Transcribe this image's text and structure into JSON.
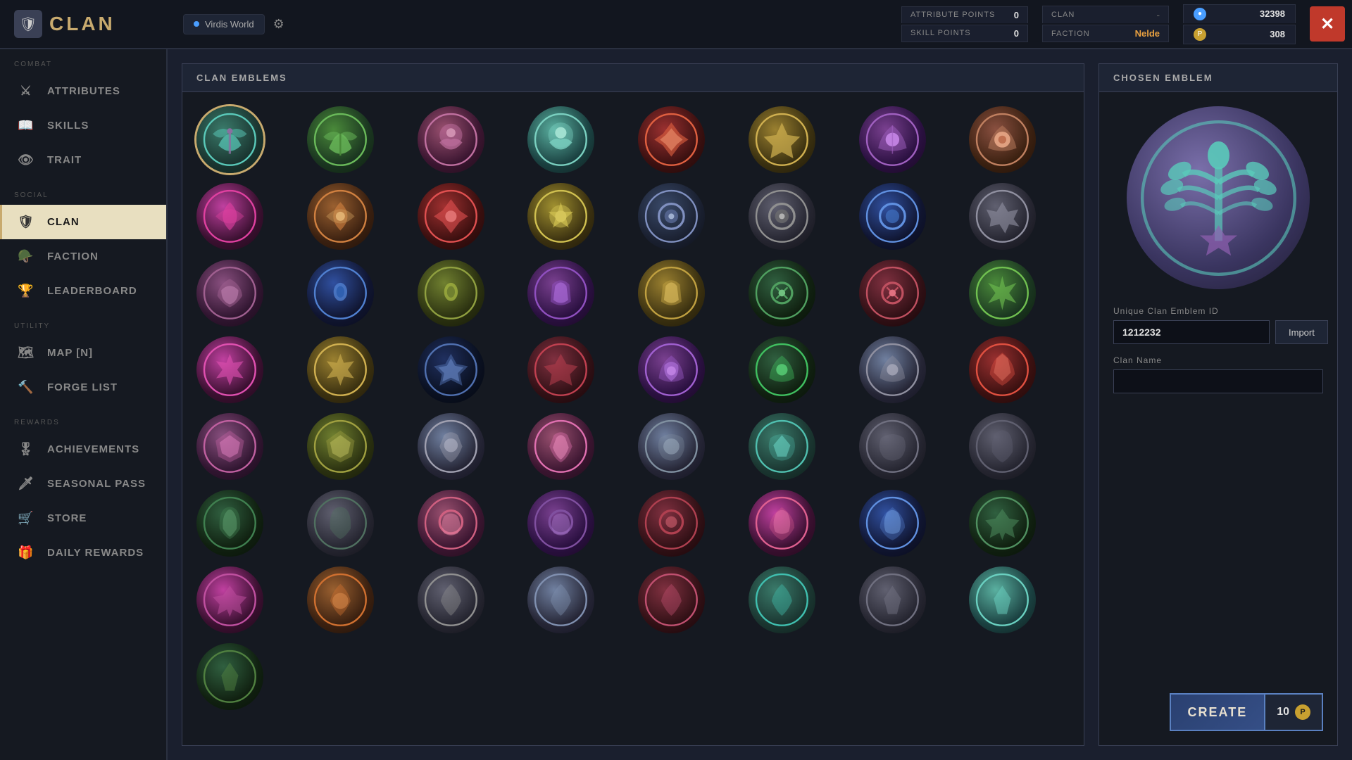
{
  "topbar": {
    "logo": "CLAN",
    "tab_world": "Virdis World",
    "attribute_points_label": "ATTRIBUTE POINTS",
    "attribute_points_value": "0",
    "skill_points_label": "SKILL POINTS",
    "skill_points_value": "0",
    "clan_label": "CLAN",
    "clan_value": "-",
    "faction_label": "FACTION",
    "faction_value": "Nelde",
    "currency1_value": "32398",
    "currency2_value": "308",
    "close_label": "✕"
  },
  "sidebar": {
    "combat_label": "COMBAT",
    "social_label": "SOCIAL",
    "utility_label": "UTILITY",
    "rewards_label": "REWARDS",
    "items": [
      {
        "id": "attributes",
        "label": "ATTRIBUTES",
        "icon": "⚔"
      },
      {
        "id": "skills",
        "label": "SKILLS",
        "icon": "📖"
      },
      {
        "id": "trait",
        "label": "TRAIT",
        "icon": "👁"
      },
      {
        "id": "clan",
        "label": "CLAN",
        "icon": "🛡",
        "active": true
      },
      {
        "id": "faction",
        "label": "FACTION",
        "icon": "🪖"
      },
      {
        "id": "leaderboard",
        "label": "LEADERBOARD",
        "icon": "🏆"
      },
      {
        "id": "map",
        "label": "MAP [N]",
        "icon": "🗺"
      },
      {
        "id": "forge",
        "label": "FORGE LIST",
        "icon": "🔨"
      },
      {
        "id": "achievements",
        "label": "ACHIEVEMENTS",
        "icon": "🎖"
      },
      {
        "id": "seasonal",
        "label": "SEASONAL PASS",
        "icon": "🗡"
      },
      {
        "id": "store",
        "label": "STORE",
        "icon": "🛒"
      },
      {
        "id": "daily",
        "label": "DAILY REWARDS",
        "icon": "🎁"
      }
    ]
  },
  "emblems_panel": {
    "header": "CLAN EMBLEMS"
  },
  "chosen_panel": {
    "header": "CHOSEN EMBLEM",
    "emblem_id_label": "Unique Clan Emblem ID",
    "emblem_id_value": "1212232",
    "import_label": "Import",
    "clan_name_label": "Clan Name",
    "clan_name_value": "",
    "clan_name_placeholder": "",
    "create_label": "CREATE",
    "create_cost": "10"
  }
}
